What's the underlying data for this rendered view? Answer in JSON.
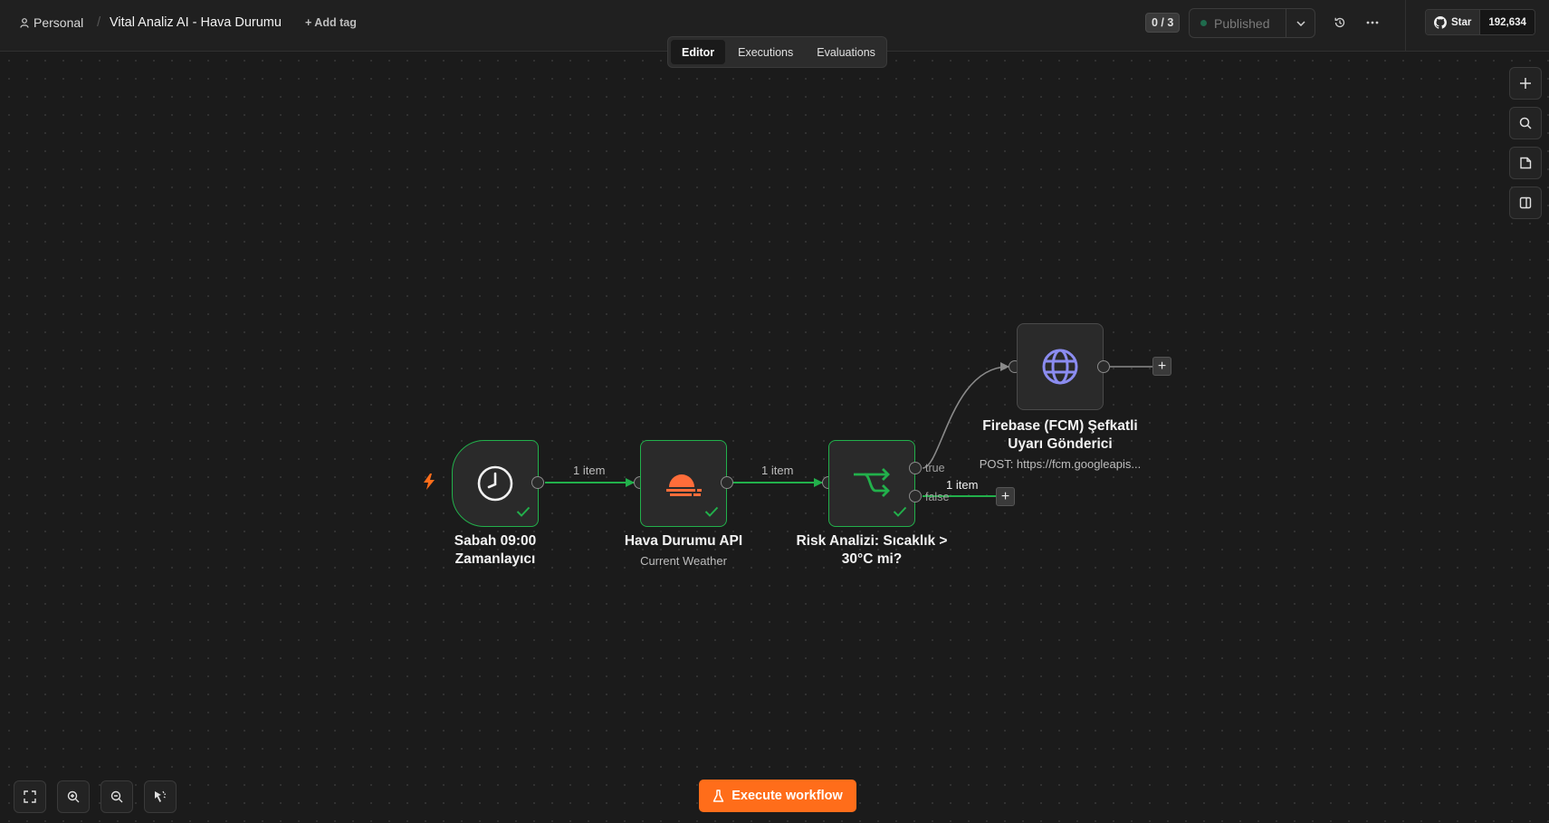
{
  "header": {
    "breadcrumb_project": "Personal",
    "breadcrumb_separator": "/",
    "workflow_title": "Vital Analiz AI - Hava Durumu",
    "add_tag_label": "+ Add tag",
    "counter": "0 / 3",
    "publish_label": "Published",
    "github_star_label": "Star",
    "github_star_count": "192,634"
  },
  "view_tabs": [
    {
      "label": "Editor",
      "active": true
    },
    {
      "label": "Executions",
      "active": false
    },
    {
      "label": "Evaluations",
      "active": false
    }
  ],
  "nodes": {
    "trigger": {
      "title": "Sabah 09:00 Zamanlayıcı",
      "title_line1": "Sabah 09:00",
      "title_line2": "Zamanlayıcı",
      "icon": "clock-icon",
      "status": "success"
    },
    "weather": {
      "title": "Hava Durumu API",
      "subtitle": "Current Weather",
      "icon": "weather-icon",
      "status": "success"
    },
    "risk": {
      "title_line1": "Risk Analizi: Sıcaklık >",
      "title_line2": "30°C mi?",
      "icon": "if-branch-icon",
      "status": "success",
      "branch_true": "true",
      "branch_false": "false"
    },
    "firebase": {
      "title_line1": "Firebase (FCM) Şefkatli",
      "title_line2": "Uyarı Gönderici",
      "subtitle": "POST: https://fcm.googleapis...",
      "icon": "globe-icon"
    }
  },
  "edges": {
    "trigger_to_weather": "1 item",
    "weather_to_risk": "1 item",
    "risk_false_output": "1 item"
  },
  "execute_button_label": "Execute workflow",
  "colors": {
    "success": "#22b04b",
    "accent": "#ff6d1a",
    "canvas": "#1b1b1b",
    "http_icon": "#8b8cf0"
  }
}
